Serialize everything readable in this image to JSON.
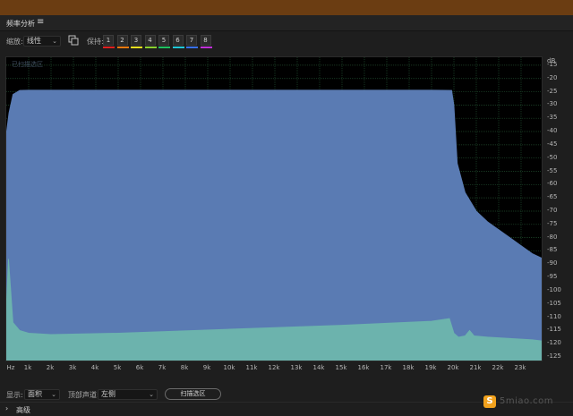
{
  "panel": {
    "title": "频率分析",
    "menu_icon": "hamburger-menu-icon"
  },
  "toolbar": {
    "scale_label": "缩放:",
    "scale_value": "线性",
    "copy_icon": "copy-icon",
    "hold_label": "保持:",
    "hold_buttons": [
      {
        "label": "1",
        "color": "#e02020"
      },
      {
        "label": "2",
        "color": "#f07a10"
      },
      {
        "label": "3",
        "color": "#f0e020"
      },
      {
        "label": "4",
        "color": "#8ad030"
      },
      {
        "label": "5",
        "color": "#20c060"
      },
      {
        "label": "6",
        "color": "#20c8d8"
      },
      {
        "label": "7",
        "color": "#3870f0"
      },
      {
        "label": "8",
        "color": "#c030d8"
      }
    ]
  },
  "plot": {
    "selection_label": "已扫描选区"
  },
  "chart_data": {
    "type": "area",
    "xlabel": "Hz",
    "x_ticks": [
      "1k",
      "2k",
      "3k",
      "4k",
      "5k",
      "6k",
      "7k",
      "8k",
      "9k",
      "10k",
      "11k",
      "12k",
      "13k",
      "14k",
      "15k",
      "16k",
      "17k",
      "18k",
      "19k",
      "20k",
      "21k",
      "22k",
      "23k"
    ],
    "y_unit": "dB",
    "y_ticks": [
      "-15",
      "-20",
      "-25",
      "-30",
      "-35",
      "-40",
      "-45",
      "-50",
      "-55",
      "-60",
      "-65",
      "-70",
      "-75",
      "-80",
      "-85",
      "-90",
      "-95",
      "-100",
      "-105",
      "-110",
      "-115",
      "-120",
      "-125"
    ],
    "xlim": [
      0,
      24000
    ],
    "ylim": [
      -127,
      -12
    ],
    "grid": true,
    "series": [
      {
        "color": "#5a7bb3",
        "points": [
          [
            0,
            -41
          ],
          [
            120,
            -33
          ],
          [
            300,
            -26
          ],
          [
            600,
            -24.5
          ],
          [
            1000,
            -24.4
          ],
          [
            10000,
            -24.4
          ],
          [
            19000,
            -24.4
          ],
          [
            19900,
            -24.5
          ],
          [
            20000,
            -30
          ],
          [
            20150,
            -52
          ],
          [
            20500,
            -63
          ],
          [
            21000,
            -70
          ],
          [
            21500,
            -74
          ],
          [
            22000,
            -77
          ],
          [
            22500,
            -80
          ],
          [
            23000,
            -83
          ],
          [
            23500,
            -86
          ],
          [
            24000,
            -88
          ]
        ]
      },
      {
        "color": "#6cb3ad",
        "points": [
          [
            0,
            -106
          ],
          [
            100,
            -88
          ],
          [
            200,
            -100
          ],
          [
            300,
            -112
          ],
          [
            600,
            -115
          ],
          [
            1000,
            -116
          ],
          [
            2000,
            -116.5
          ],
          [
            5000,
            -116
          ],
          [
            10000,
            -114.5
          ],
          [
            15000,
            -113
          ],
          [
            19000,
            -111.5
          ],
          [
            19800,
            -110.5
          ],
          [
            20000,
            -116
          ],
          [
            20200,
            -117.5
          ],
          [
            20500,
            -117
          ],
          [
            20700,
            -115
          ],
          [
            20900,
            -117
          ],
          [
            21500,
            -117.5
          ],
          [
            22500,
            -118
          ],
          [
            23500,
            -118.5
          ],
          [
            24000,
            -119
          ]
        ]
      }
    ]
  },
  "bottom": {
    "display_label": "显示:",
    "display_value": "面积",
    "top_channel_label": "顶部声道:",
    "top_channel_value": "左侧",
    "scan_button": "扫描选区"
  },
  "advanced": {
    "label": "高级"
  },
  "watermark": {
    "logo_text": "S",
    "text": "5miao.com"
  }
}
